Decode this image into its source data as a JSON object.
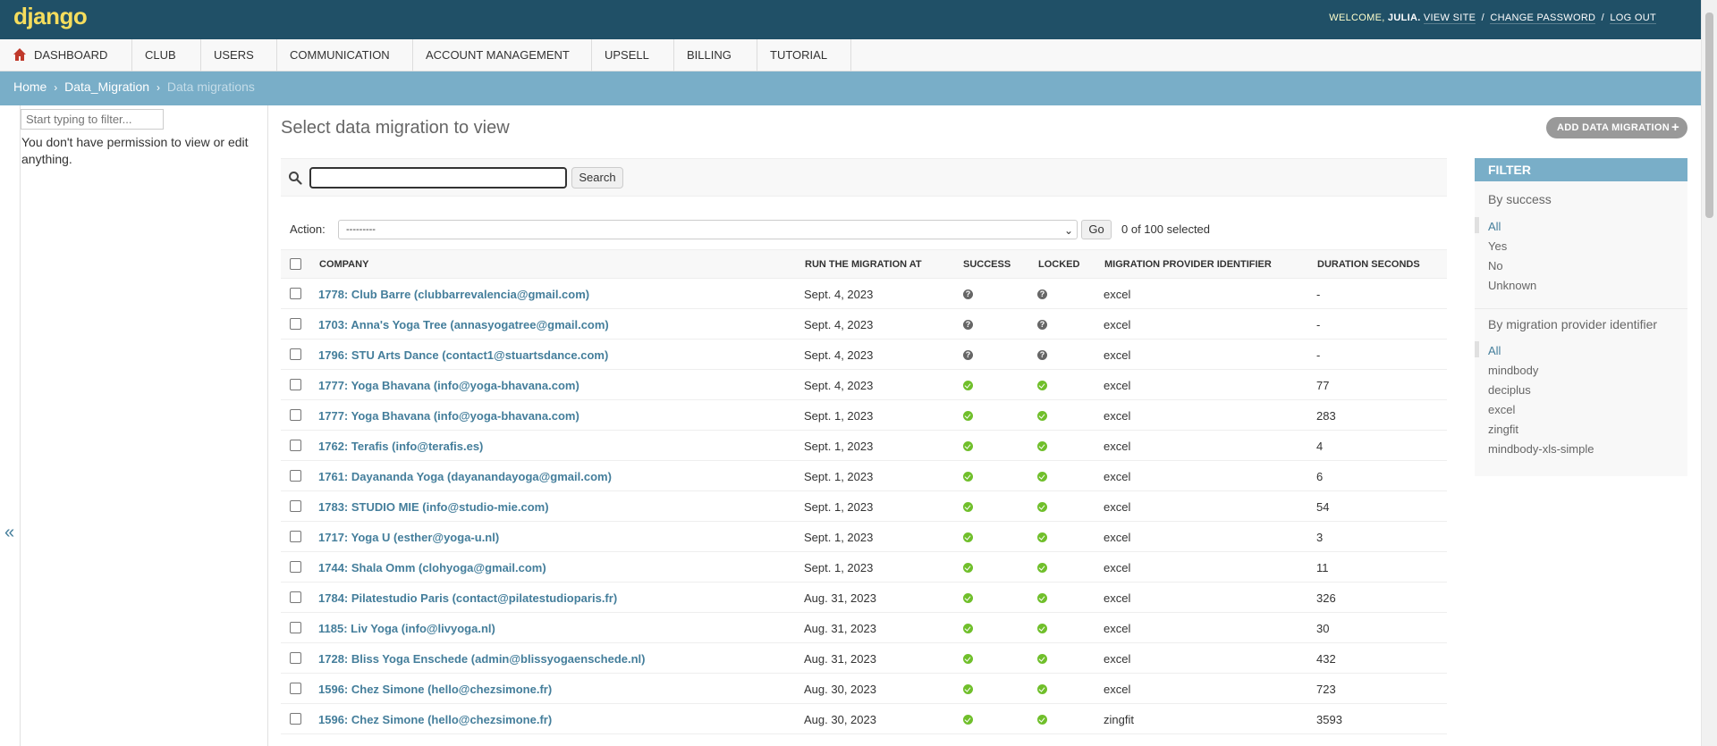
{
  "header": {
    "brand": "django",
    "welcome": "WELCOME,",
    "username": "JULIA.",
    "view_site": "VIEW SITE",
    "change_password": "CHANGE PASSWORD",
    "log_out": "LOG OUT",
    "sep": "/"
  },
  "nav": {
    "items": [
      {
        "label": "DASHBOARD",
        "icon": "home-icon"
      },
      {
        "label": "CLUB"
      },
      {
        "label": "USERS"
      },
      {
        "label": "COMMUNICATION"
      },
      {
        "label": "ACCOUNT MANAGEMENT"
      },
      {
        "label": "UPSELL"
      },
      {
        "label": "BILLING"
      },
      {
        "label": "TUTORIAL"
      }
    ]
  },
  "breadcrumbs": {
    "home": "Home",
    "app": "Data_Migration",
    "current": "Data migrations",
    "sep": "›"
  },
  "sidebar": {
    "filter_placeholder": "Start typing to filter...",
    "permission_text": "You don't have permission to view or edit anything.",
    "collapse": "«"
  },
  "content": {
    "title": "Select data migration to view",
    "add_button": "ADD DATA MIGRATION",
    "add_icon": "+",
    "search_button": "Search",
    "action_label": "Action:",
    "action_value": "---------",
    "go_button": "Go",
    "selected_count": "0 of 100 selected"
  },
  "table": {
    "headers": [
      "COMPANY",
      "RUN THE MIGRATION AT",
      "SUCCESS",
      "LOCKED",
      "MIGRATION PROVIDER IDENTIFIER",
      "DURATION SECONDS"
    ],
    "rows": [
      {
        "company": "1778: Club Barre (clubbarrevalencia@gmail.com)",
        "run_at": "Sept. 4, 2023",
        "success": "unknown",
        "locked": "unknown",
        "provider": "excel",
        "duration": "-"
      },
      {
        "company": "1703: Anna's Yoga Tree (annasyogatree@gmail.com)",
        "run_at": "Sept. 4, 2023",
        "success": "unknown",
        "locked": "unknown",
        "provider": "excel",
        "duration": "-"
      },
      {
        "company": "1796: STU Arts Dance (contact1@stuartsdance.com)",
        "run_at": "Sept. 4, 2023",
        "success": "unknown",
        "locked": "unknown",
        "provider": "excel",
        "duration": "-"
      },
      {
        "company": "1777: Yoga Bhavana (info@yoga-bhavana.com)",
        "run_at": "Sept. 4, 2023",
        "success": "yes",
        "locked": "yes",
        "provider": "excel",
        "duration": "77"
      },
      {
        "company": "1777: Yoga Bhavana (info@yoga-bhavana.com)",
        "run_at": "Sept. 1, 2023",
        "success": "yes",
        "locked": "yes",
        "provider": "excel",
        "duration": "283"
      },
      {
        "company": "1762: Terafis (info@terafis.es)",
        "run_at": "Sept. 1, 2023",
        "success": "yes",
        "locked": "yes",
        "provider": "excel",
        "duration": "4"
      },
      {
        "company": "1761: Dayananda Yoga (dayanandayoga@gmail.com)",
        "run_at": "Sept. 1, 2023",
        "success": "yes",
        "locked": "yes",
        "provider": "excel",
        "duration": "6"
      },
      {
        "company": "1783: STUDIO MIE (info@studio-mie.com)",
        "run_at": "Sept. 1, 2023",
        "success": "yes",
        "locked": "yes",
        "provider": "excel",
        "duration": "54"
      },
      {
        "company": "1717: Yoga U (esther@yoga-u.nl)",
        "run_at": "Sept. 1, 2023",
        "success": "yes",
        "locked": "yes",
        "provider": "excel",
        "duration": "3"
      },
      {
        "company": "1744: Shala Omm (clohyoga@gmail.com)",
        "run_at": "Sept. 1, 2023",
        "success": "yes",
        "locked": "yes",
        "provider": "excel",
        "duration": "11"
      },
      {
        "company": "1784: Pilatestudio Paris (contact@pilatestudioparis.fr)",
        "run_at": "Aug. 31, 2023",
        "success": "yes",
        "locked": "yes",
        "provider": "excel",
        "duration": "326"
      },
      {
        "company": "1185: Liv Yoga (info@livyoga.nl)",
        "run_at": "Aug. 31, 2023",
        "success": "yes",
        "locked": "yes",
        "provider": "excel",
        "duration": "30"
      },
      {
        "company": "1728: Bliss Yoga Enschede (admin@blissyogaenschede.nl)",
        "run_at": "Aug. 31, 2023",
        "success": "yes",
        "locked": "yes",
        "provider": "excel",
        "duration": "432"
      },
      {
        "company": "1596: Chez Simone (hello@chezsimone.fr)",
        "run_at": "Aug. 30, 2023",
        "success": "yes",
        "locked": "yes",
        "provider": "excel",
        "duration": "723"
      },
      {
        "company": "1596: Chez Simone (hello@chezsimone.fr)",
        "run_at": "Aug. 30, 2023",
        "success": "yes",
        "locked": "yes",
        "provider": "zingfit",
        "duration": "3593"
      }
    ]
  },
  "filter": {
    "title": "FILTER",
    "by_success": "By success",
    "success_options": [
      "All",
      "Yes",
      "No",
      "Unknown"
    ],
    "by_provider": "By migration provider identifier",
    "provider_options": [
      "All",
      "mindbody",
      "deciplus",
      "excel",
      "zingfit",
      "mindbody-xls-simple"
    ]
  },
  "colors": {
    "header_bg": "#205067",
    "breadcrumb_bg": "#79aec8",
    "link": "#447e9b",
    "success_green": "#70bf2b",
    "brand_yellow": "#f5dd5d"
  }
}
